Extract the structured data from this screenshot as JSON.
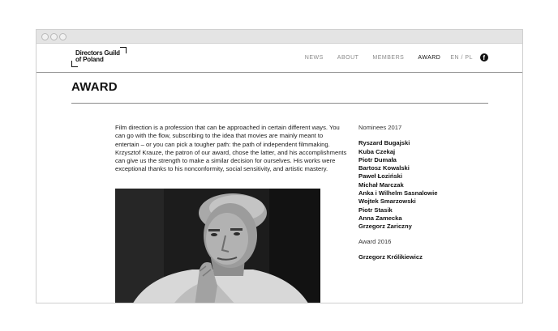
{
  "logo": {
    "line1": "Directors Guild",
    "line2": "of Poland"
  },
  "nav": {
    "items": [
      {
        "label": "NEWS",
        "active": false
      },
      {
        "label": "ABOUT",
        "active": false
      },
      {
        "label": "MEMBERS",
        "active": false
      },
      {
        "label": "AWARD",
        "active": true
      }
    ],
    "language": "EN / PL",
    "social_icon": "facebook-icon"
  },
  "page": {
    "title": "AWARD",
    "intro": "Film direction is a profession that can be approached in certain different ways. You can go with the flow, subscribing to the idea that movies are mainly meant to entertain – or you can pick a tougher path: the path of independent filmmaking. Krzysztof Krauze, the patron of our award, chose the latter, and his accomplishments can give us the strength to make a similar decision for ourselves. His works were exceptional thanks to his nonconformity, social sensitivity, and artistic mastery."
  },
  "sidebar": {
    "nominees_heading": "Nominees 2017",
    "nominees": [
      "Ryszard Bugajski",
      "Kuba Czekaj",
      "Piotr Dumała",
      "Bartosz Kowalski",
      "Paweł Łoziński",
      "Michał Marczak",
      "Anka i Wilhelm Sasnalowie",
      "Wojtek Smarzowski",
      "Piotr Stasik",
      "Anna Zamecka",
      "Grzegorz Zariczny"
    ],
    "award_heading": "Award 2016",
    "award_winner": "Grzegorz Królikiewicz"
  },
  "colors": {
    "accent": "#111111",
    "muted": "#8a8a8a",
    "chrome": "#e4e4e4"
  }
}
